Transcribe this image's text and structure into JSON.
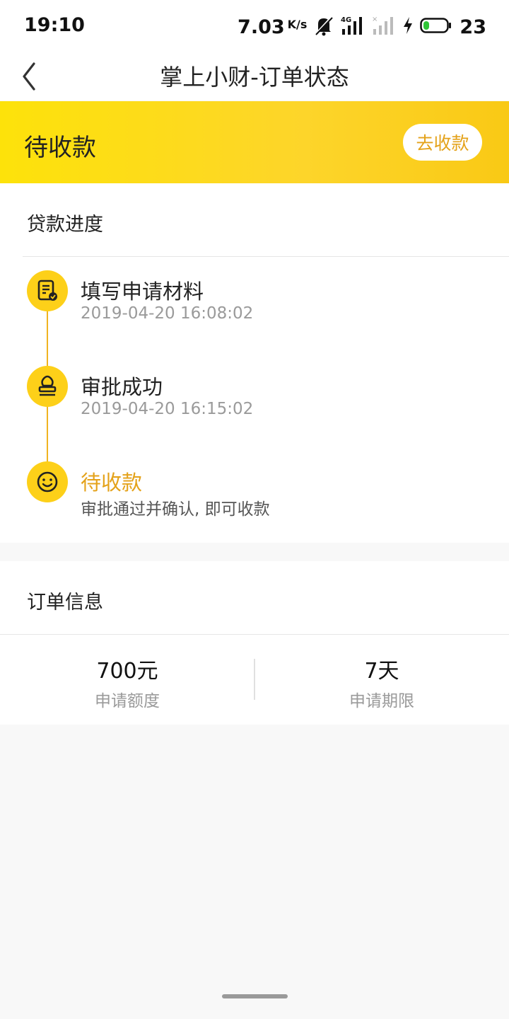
{
  "status_bar": {
    "time": "19:10",
    "speed": "7.03",
    "speed_unit": "K/s",
    "battery": "23",
    "icons": [
      "bell-muted-icon",
      "signal-4g-icon",
      "signal-no-service-icon",
      "charging-icon",
      "battery-icon"
    ]
  },
  "header": {
    "back_icon": "back-chevron-icon",
    "title": "掌上小财-订单状态"
  },
  "banner": {
    "status": "待收款",
    "action_label": "去收款",
    "colors": {
      "start": "#fde20a",
      "end": "#f9c915",
      "accent": "#e4a21a"
    }
  },
  "progress": {
    "title": "贷款进度",
    "steps": [
      {
        "icon": "document-check-icon",
        "title": "填写申请材料",
        "subtitle": "2019-04-20 16:08:02"
      },
      {
        "icon": "stamp-icon",
        "title": "审批成功",
        "subtitle": "2019-04-20 16:15:02"
      },
      {
        "icon": "smiley-icon",
        "title": "待收款",
        "subtitle": "审批通过并确认, 即可收款"
      }
    ]
  },
  "order": {
    "title": "订单信息",
    "amount": {
      "value": "700元",
      "label": "申请额度"
    },
    "term": {
      "value": "7天",
      "label": "申请期限"
    }
  }
}
